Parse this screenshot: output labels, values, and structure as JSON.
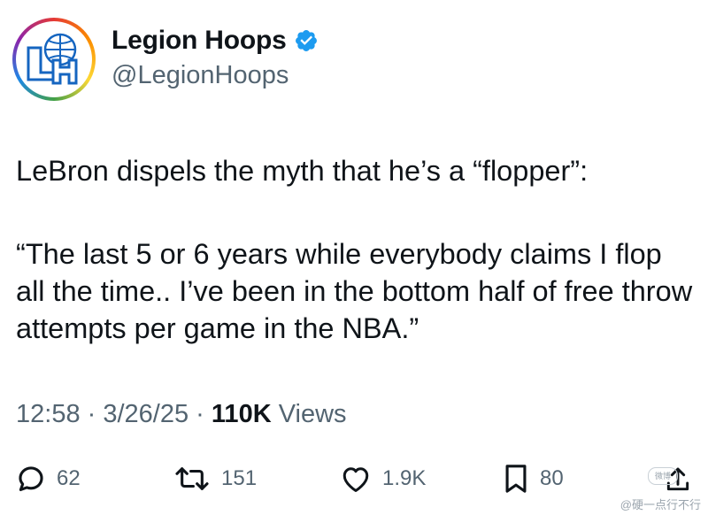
{
  "account": {
    "display_name": "Legion Hoops",
    "handle": "@LegionHoops",
    "verified": true,
    "avatar_letters": "LH",
    "verified_color": "#1d9bf0"
  },
  "tweet": {
    "line1": "LeBron dispels the myth that he’s a “flopper”:",
    "quote": "“The last 5 or 6 years while everybody claims I flop all the time.. I’ve been in the bottom half of free throw attempts per game in the NBA.”"
  },
  "meta": {
    "time": "12:58",
    "separator1": " · ",
    "date": "3/26/25",
    "separator2": " · ",
    "views_count": "110K",
    "views_label": " Views"
  },
  "actions": {
    "replies": "62",
    "reposts": "151",
    "likes": "1.9K",
    "bookmarks": "80"
  },
  "watermark": {
    "text": "@硬一点行不行",
    "badge": "微博"
  }
}
